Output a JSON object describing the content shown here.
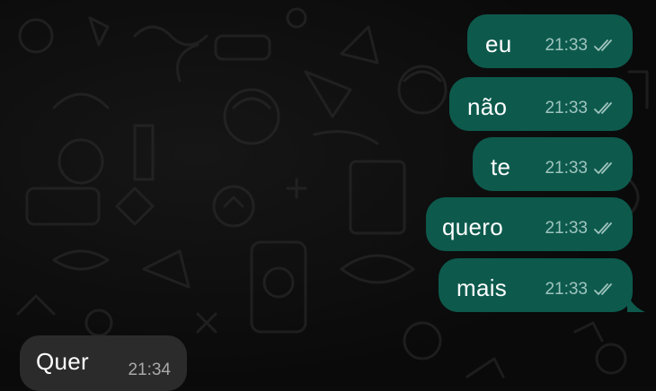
{
  "messages": [
    {
      "text": "eu",
      "time": "21:33",
      "status": "double-check-read"
    },
    {
      "text": "não",
      "time": "21:33",
      "status": "double-check-read"
    },
    {
      "text": "te",
      "time": "21:33",
      "status": "double-check-read"
    },
    {
      "text": "quero",
      "time": "21:33",
      "status": "double-check-read"
    },
    {
      "text": "mais",
      "time": "21:33",
      "status": "double-check-read"
    },
    {
      "text": "Quer",
      "time": "21:34",
      "status": "incoming"
    }
  ],
  "colors": {
    "outgoing_bubble": "#0d5a4d",
    "incoming_bubble": "#2b2b2b",
    "background": "#0b0b0b",
    "check_marks": "#9fc4bd"
  }
}
